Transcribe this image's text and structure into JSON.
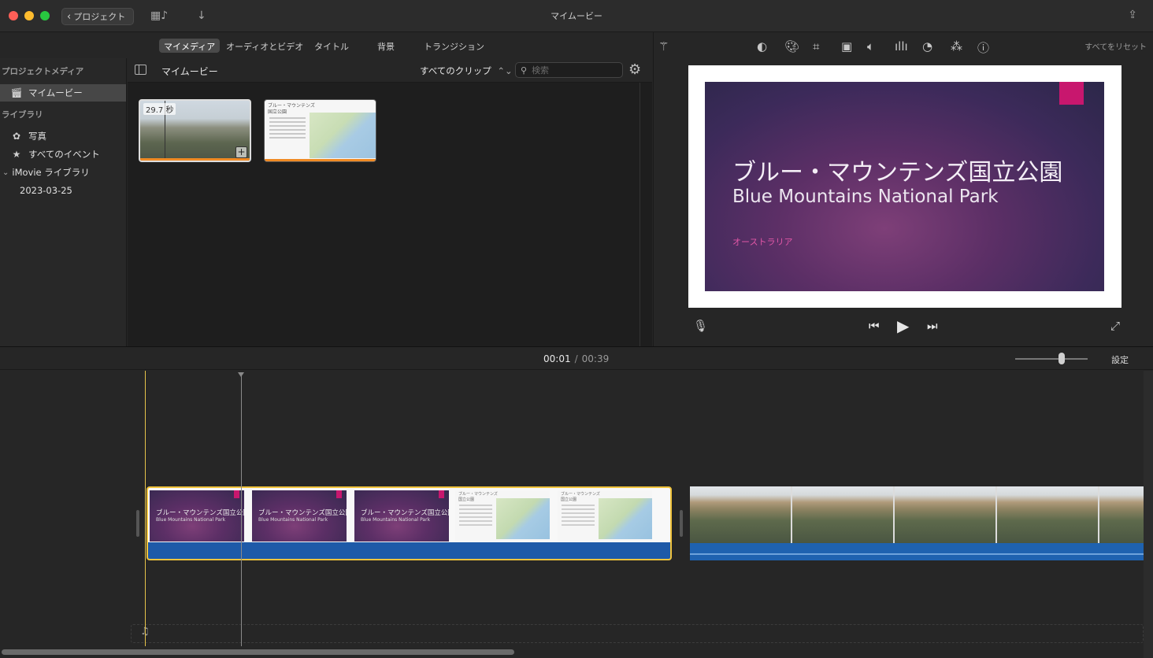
{
  "window": {
    "title": "マイムービー",
    "back_label": "プロジェクト"
  },
  "browser_tabs": [
    "マイメディア",
    "オーディオとビデオ",
    "タイトル",
    "背景",
    "トランジション"
  ],
  "sidebar": {
    "project_media_header": "プロジェクトメディア",
    "project_item": "マイムービー",
    "library_header": "ライブラリ",
    "items": [
      "写真",
      "すべてのイベント"
    ],
    "library_name": "iMovie ライブラリ",
    "event": "2023-03-25"
  },
  "browser": {
    "title": "マイムービー",
    "clip_filter": "すべてのクリップ",
    "search_placeholder": "検索",
    "clip1_duration": "29.7 秒",
    "clip2_title_line1": "ブルー・マウンテンズ",
    "clip2_title_line2": "国立公園"
  },
  "viewer": {
    "reset_all": "すべてをリセット",
    "slide_title_jp": "ブルー・マウンテンズ国立公園",
    "slide_title_en": "Blue Mountains National Park",
    "slide_subtitle": "オーストラリア"
  },
  "timeline": {
    "current_time": "00:01",
    "separator": "/",
    "total_time": "00:39",
    "settings_label": "設定",
    "frame_title_jp": "ブルー・マウンテンズ国立公園",
    "frame_title_en": "Blue Mountains National Park",
    "map_title_line1": "ブルー・マウンテンズ",
    "map_title_line2": "国立公園"
  },
  "colors": {
    "accent_selection": "#f0c33c",
    "ribbon": "#c8176e",
    "audio_track": "#1e5aa8",
    "clip_bar": "#f08a24"
  }
}
